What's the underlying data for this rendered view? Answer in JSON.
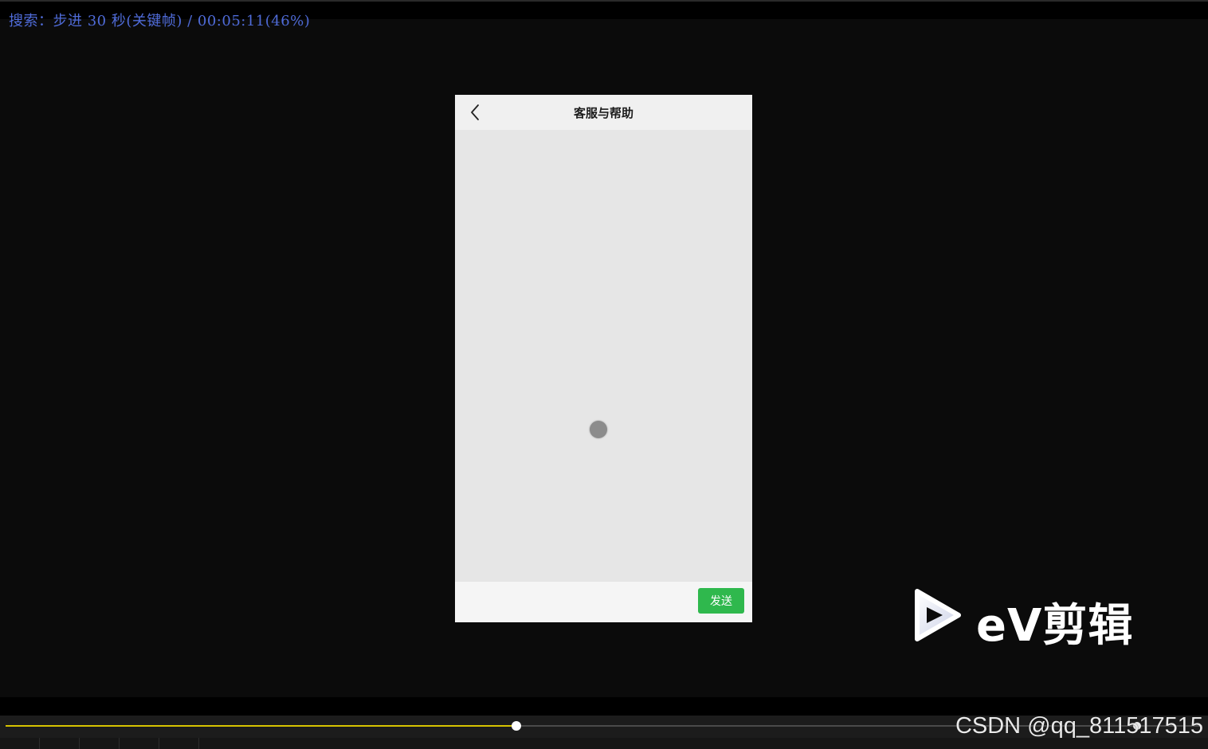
{
  "osd": {
    "status_text": "搜索：步进 30 秒(关键帧) / 00:05:11(46%)"
  },
  "phone": {
    "title": "客服与帮助",
    "back_icon": "chevron-left-icon",
    "send_label": "发送",
    "loading_icon": "loading-spinner-icon"
  },
  "watermark_logo": {
    "brand_text": "eV剪辑",
    "icon": "play-triangle-icon"
  },
  "player": {
    "progress_fraction": 0.427,
    "playhead_color": "#d6c300",
    "csdn_watermark": "CSDN @qq_811517515"
  },
  "colors": {
    "osd_text": "#4f6bd8",
    "send_button": "#2fb84d",
    "background": "#0b0b0b"
  }
}
